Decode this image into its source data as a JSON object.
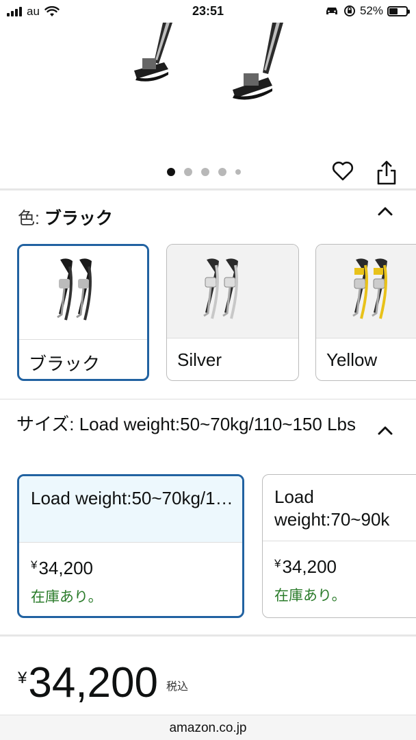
{
  "status_bar": {
    "carrier": "au",
    "time": "23:51",
    "battery": "52%",
    "battery_level": 0.52
  },
  "product_image": {
    "page_count": 5,
    "current_page": 1
  },
  "icons": {
    "wishlist": "heart-icon",
    "share": "share-icon",
    "collapse": "chevron-up-icon"
  },
  "color_section": {
    "label": "色:",
    "selected_value": "ブラック",
    "options": [
      {
        "name": "ブラック",
        "accent": "#1a1a1a"
      },
      {
        "name": "Silver",
        "accent": "#9a9a9a"
      },
      {
        "name": "Yellow",
        "accent": "#e8c21a"
      }
    ]
  },
  "size_section": {
    "label": "サイズ:",
    "selected_value": "Load weight:50~70kg/110~150 Lbs",
    "options": [
      {
        "title": "Load weight:50~70kg/1…",
        "price": "34,200",
        "currency": "¥",
        "stock": "在庫あり。"
      },
      {
        "title": "Load weight:70~90k",
        "price": "34,200",
        "currency": "¥",
        "stock": "在庫あり。"
      }
    ]
  },
  "price": {
    "currency": "¥",
    "amount": "34,200",
    "tax_note": "税込"
  },
  "browser": {
    "url": "amazon.co.jp"
  },
  "colors": {
    "selected_border": "#2162a1",
    "selected_fill": "#edf8fd",
    "in_stock": "#2a7b2a"
  }
}
